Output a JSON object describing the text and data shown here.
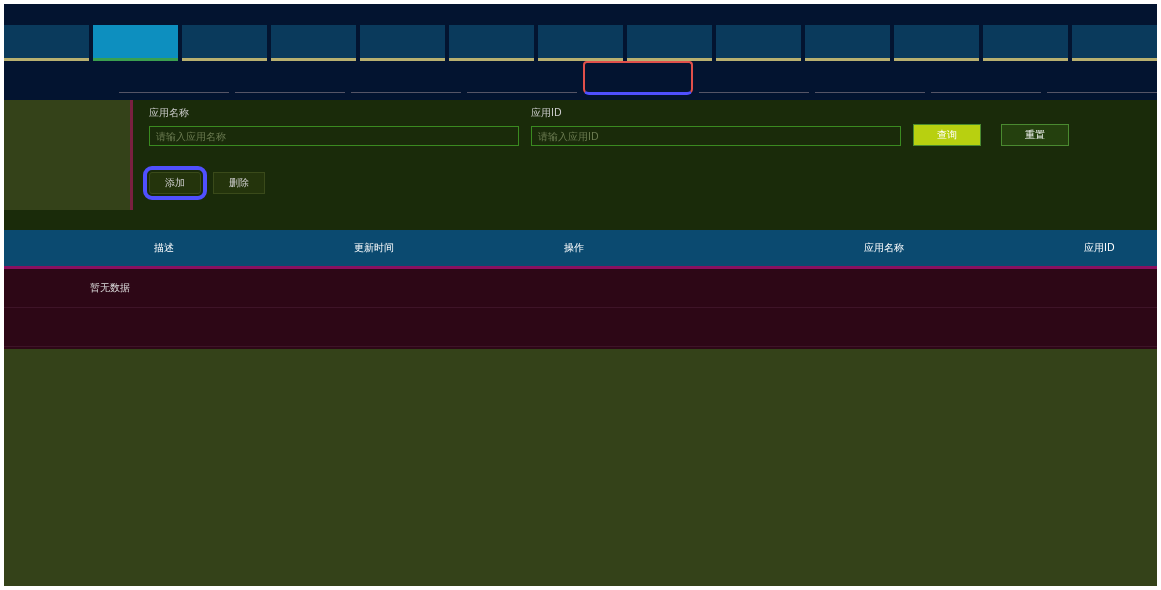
{
  "top_tabs": [
    {
      "selected": false
    },
    {
      "selected": true
    },
    {
      "selected": false
    },
    {
      "selected": false
    },
    {
      "selected": false
    },
    {
      "selected": false
    },
    {
      "selected": false
    },
    {
      "selected": false
    },
    {
      "selected": false
    },
    {
      "selected": false
    },
    {
      "selected": false
    },
    {
      "selected": false
    },
    {
      "selected": false
    }
  ],
  "sub_tabs": [
    {
      "selected": false
    },
    {
      "selected": false
    },
    {
      "selected": false
    },
    {
      "selected": false
    },
    {
      "selected": true
    },
    {
      "selected": false
    },
    {
      "selected": false
    },
    {
      "selected": false
    },
    {
      "selected": false
    }
  ],
  "filters": [
    {
      "label": "应用名称",
      "placeholder": "请输入应用名称"
    },
    {
      "label": "应用ID",
      "placeholder": "请输入应用ID"
    }
  ],
  "search_buttons": [
    {
      "label": "查询",
      "kind": "primary"
    },
    {
      "label": "重置",
      "kind": "secondary"
    }
  ],
  "actions": [
    {
      "label": "添加",
      "selected": true
    },
    {
      "label": "删除",
      "selected": false
    }
  ],
  "table": {
    "columns": [
      "描述",
      "更新时间",
      "操作",
      "应用名称",
      "应用ID"
    ],
    "empty_text": "暂无数据"
  }
}
